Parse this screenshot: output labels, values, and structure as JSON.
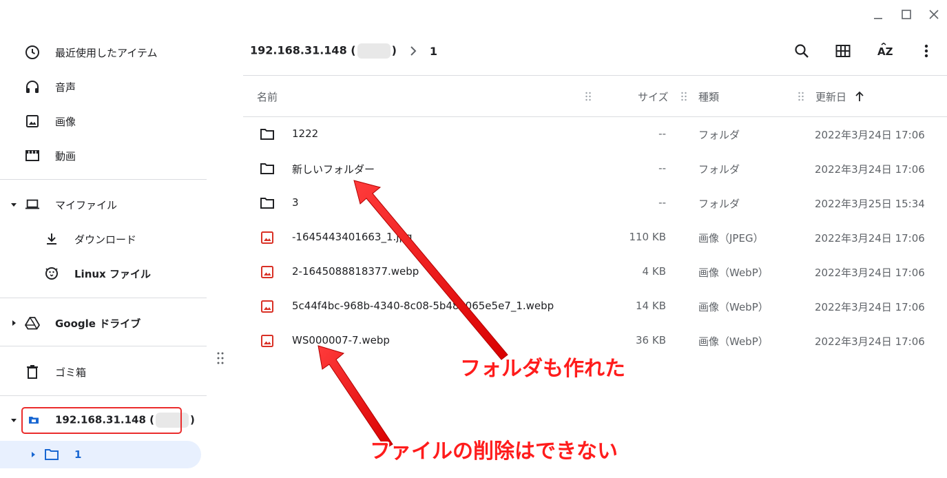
{
  "window": {
    "minimize_label": "minimize",
    "maximize_label": "maximize",
    "close_label": "close"
  },
  "sidebar": {
    "items": [
      {
        "label": "最近使用したアイテム",
        "icon": "clock-icon"
      },
      {
        "label": "音声",
        "icon": "headphones-icon"
      },
      {
        "label": "画像",
        "icon": "image-icon"
      },
      {
        "label": "動画",
        "icon": "video-icon"
      }
    ],
    "my_files": {
      "label": "マイファイル",
      "icon": "laptop-icon"
    },
    "downloads": {
      "label": "ダウンロード",
      "icon": "download-icon"
    },
    "linux": {
      "label": "Linux ファイル",
      "icon": "penguin-icon"
    },
    "google_drive": {
      "label": "Google ドライブ",
      "icon": "drive-icon"
    },
    "trash": {
      "label": "ゴミ箱",
      "icon": "trash-icon"
    },
    "smb_share": {
      "label_prefix": "192.168.31.148 (",
      "label_suffix": ")",
      "icon": "network-share-icon"
    },
    "selected_folder": {
      "label": "1",
      "icon": "folder-icon"
    }
  },
  "breadcrumb": {
    "root_prefix": "192.168.31.148 (",
    "root_suffix": ")",
    "current": "1"
  },
  "toolbar": {
    "search": "search-icon",
    "grid": "grid-view-icon",
    "sort": "sort-az-icon",
    "more": "more-vert-icon"
  },
  "table": {
    "headers": {
      "name": "名前",
      "size": "サイズ",
      "type": "種類",
      "modified": "更新日"
    },
    "rows": [
      {
        "name": "1222",
        "size": "--",
        "type": "フォルダ",
        "date": "2022年3月24日 17:06",
        "kind": "folder"
      },
      {
        "name": "新しいフォルダー",
        "size": "--",
        "type": "フォルダ",
        "date": "2022年3月24日 17:06",
        "kind": "folder"
      },
      {
        "name": "3",
        "size": "--",
        "type": "フォルダ",
        "date": "2022年3月25日 15:34",
        "kind": "folder"
      },
      {
        "name": "-1645443401663_1.jpg",
        "size": "110 KB",
        "type": "画像（JPEG）",
        "date": "2022年3月24日 17:06",
        "kind": "image"
      },
      {
        "name": "2-1645088818377.webp",
        "size": "4 KB",
        "type": "画像（WebP）",
        "date": "2022年3月24日 17:06",
        "kind": "image"
      },
      {
        "name": "5c44f4bc-968b-4340-8c08-5b48a065e5e7_1.webp",
        "size": "14 KB",
        "type": "画像（WebP）",
        "date": "2022年3月24日 17:06",
        "kind": "image"
      },
      {
        "name": "WS000007-7.webp",
        "size": "36 KB",
        "type": "画像（WebP）",
        "date": "2022年3月24日 17:06",
        "kind": "image"
      }
    ]
  },
  "annotations": {
    "folder_created": "フォルダも作れた",
    "cannot_delete": "ファイルの削除はできない"
  },
  "colors": {
    "accent": "#1967d2",
    "selected_bg": "#e8f0fe",
    "annotation_red": "#ff1c1c",
    "image_icon_red": "#d93025"
  }
}
